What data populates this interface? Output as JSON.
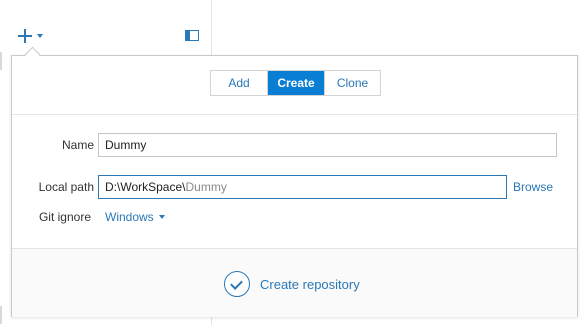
{
  "toolbar": {
    "add_icon": "plus-icon",
    "add_caret_icon": "caret-down-icon",
    "panel_toggle_icon": "sidebar-panel-icon"
  },
  "repo_dialog": {
    "tabs": [
      {
        "label": "Add",
        "selected": false
      },
      {
        "label": "Create",
        "selected": true
      },
      {
        "label": "Clone",
        "selected": false
      }
    ],
    "name": {
      "label": "Name",
      "value": "Dummy"
    },
    "local_path": {
      "label": "Local path",
      "base": "D:\\WorkSpace\\",
      "repo_name": "Dummy",
      "browse_label": "Browse"
    },
    "git_ignore": {
      "label": "Git ignore",
      "value": "Windows"
    },
    "submit": {
      "label": "Create repository",
      "icon": "check-circle-icon"
    }
  },
  "colors": {
    "accent": "#2a78b6",
    "selected_tab_bg": "#0a7ed4",
    "border": "#c9c9c9"
  }
}
